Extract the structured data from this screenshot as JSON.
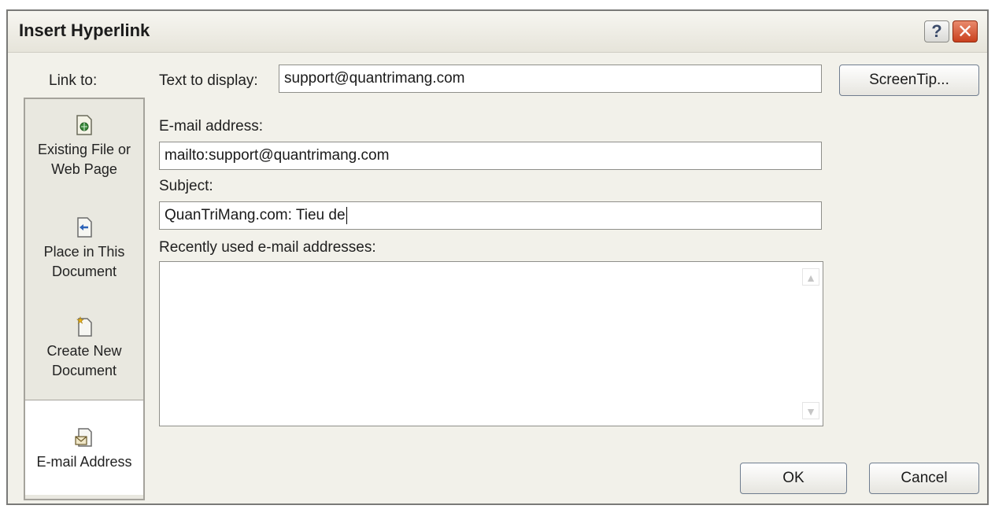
{
  "dialog": {
    "title": "Insert Hyperlink",
    "help_label": "?",
    "close_label": "✕"
  },
  "sidebar": {
    "link_to_label": "Link to:",
    "items": [
      {
        "label_line1": "Existing File or",
        "label_line2": "Web Page",
        "icon": "web-page-icon"
      },
      {
        "label_line1": "Place in This",
        "label_line2": "Document",
        "icon": "document-place-icon"
      },
      {
        "label_line1": "Create New",
        "label_line2": "Document",
        "icon": "new-document-icon"
      },
      {
        "label_line1": "E-mail Address",
        "label_line2": "",
        "icon": "email-icon",
        "selected": true
      }
    ]
  },
  "form": {
    "text_to_display_label": "Text to display:",
    "text_to_display_value": "support@quantrimang.com",
    "screentip_label": "ScreenTip...",
    "email_label": "E-mail address:",
    "email_value": "mailto:support@quantrimang.com",
    "subject_label": "Subject:",
    "subject_value": "QuanTriMang.com: Tieu de",
    "recent_label": "Recently used e-mail addresses:",
    "recent_items": []
  },
  "buttons": {
    "ok_label": "OK",
    "cancel_label": "Cancel"
  }
}
